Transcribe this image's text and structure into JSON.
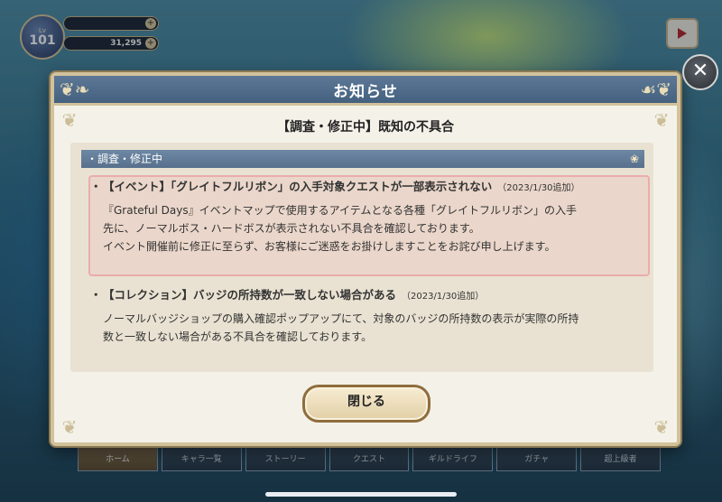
{
  "hud": {
    "level_label": "Lv",
    "level": "101",
    "bar1_value": "",
    "bar2_value": "31,295"
  },
  "dialog": {
    "title": "お知らせ",
    "heading": "【調査・修正中】既知の不具合",
    "section_label": "・調査・修正中",
    "items": [
      {
        "bullet": "・",
        "title": "【イベント】「グレイトフルリボン」の入手対象クエストが一部表示されない",
        "date": "（2023/1/30追加）",
        "body_line1": "『Grateful Days』イベントマップで使用するアイテムとなる各種「グレイトフルリボン」の入手",
        "body_line2": "先に、ノーマルボス・ハードボスが表示されない不具合を確認しております。",
        "body_line3": "イベント開催前に修正に至らず、お客様にご迷惑をお掛けしますことをお詫び申し上げます。"
      },
      {
        "bullet": "・",
        "title": "【コレクション】バッジの所持数が一致しない場合がある",
        "date": "（2023/1/30追加）",
        "body_line1": "ノーマルバッジショップの購入確認ポップアップにて、対象のバッジの所持数の表示が実際の所持",
        "body_line2": "数と一致しない場合がある不具合を確認しております。"
      }
    ],
    "close_label": "閉じる"
  },
  "nav": {
    "items": [
      "ホーム",
      "キャラ一覧",
      "ストーリー",
      "クエスト",
      "ギルドライフ",
      "ガチャ",
      "超上級者"
    ]
  },
  "icons": {
    "close": "close-icon",
    "video": "video-icon",
    "ornament": "scroll-ornament-icon"
  },
  "colors": {
    "header": "#4f6b8a",
    "panel": "#e9e2d2",
    "highlight": "#e8788a"
  }
}
